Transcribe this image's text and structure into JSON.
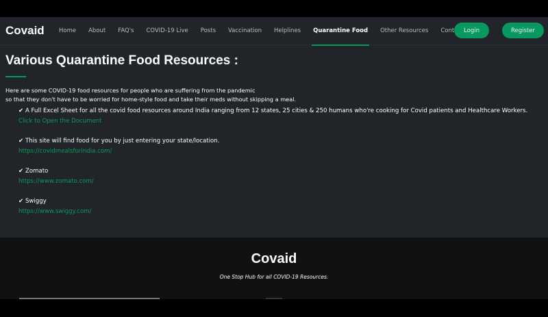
{
  "nav": {
    "brand": "Covaid",
    "items": [
      "Home",
      "About",
      "FAQ's",
      "COVID-19 Live",
      "Posts",
      "Vaccination",
      "Helplines",
      "Quarantine Food",
      "Other Resources",
      "Contact"
    ],
    "active": "Quarantine Food",
    "login": "Login",
    "register": "Register"
  },
  "main": {
    "title": "Various Quarantine Food Resources :",
    "intro1": "Here are some COVID-19 food resources for people who are suffering from the pandemic",
    "intro2": "so that they don't have to be worried for home-style food and take their meds without skipping a meal.",
    "items": [
      {
        "text": "A Full Excel Sheet for all the covid food resources around India ranging from 12 states, 25 cities & 250 humans who're cooking for Covid patients and Healthcare Workers.",
        "link": "Click to Open the Document"
      },
      {
        "text": "This site will find food for you by just entering your state/location.",
        "link": "https://covidmealsforindia.com/"
      },
      {
        "text": "Zomato",
        "link": "https://www.zomato.com/"
      },
      {
        "text": "Swiggy",
        "link": "https://www.swiggy.com/"
      }
    ]
  },
  "footer": {
    "brand": "Covaid",
    "tagline": "One Stop Hub for all COVID-19 Resources."
  }
}
